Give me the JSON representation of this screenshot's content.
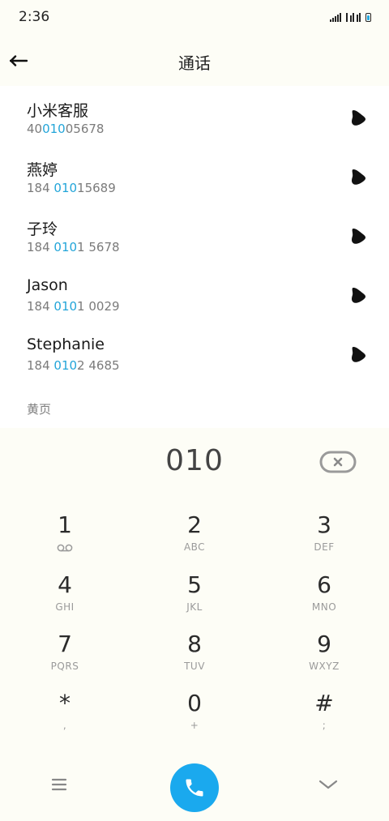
{
  "status_bar": {
    "time": "2:36"
  },
  "header": {
    "title": "通话"
  },
  "contacts": [
    {
      "name": "小米客服",
      "number_pre": "40",
      "number_match": "010",
      "number_post": "05678"
    },
    {
      "name": "燕婷",
      "number_pre": "184 ",
      "number_match": "010",
      "number_post": "15689"
    },
    {
      "name": "子玲",
      "number_pre": "184 ",
      "number_match": "010",
      "number_post": "1 5678"
    },
    {
      "name": "Jason",
      "number_pre": "184 ",
      "number_match": "010",
      "number_post": "1 0029"
    },
    {
      "name": "Stephanie",
      "number_pre": "184 ",
      "number_match": "010",
      "number_post": "2 4685"
    }
  ],
  "section_label": "黄页",
  "dialer": {
    "input": "010",
    "keys": [
      {
        "digit": "1",
        "letters": ""
      },
      {
        "digit": "2",
        "letters": "ABC"
      },
      {
        "digit": "3",
        "letters": "DEF"
      },
      {
        "digit": "4",
        "letters": "GHI"
      },
      {
        "digit": "5",
        "letters": "JKL"
      },
      {
        "digit": "6",
        "letters": "MNO"
      },
      {
        "digit": "7",
        "letters": "PQRS"
      },
      {
        "digit": "8",
        "letters": "TUV"
      },
      {
        "digit": "9",
        "letters": "WXYZ"
      },
      {
        "digit": "*",
        "letters": ","
      },
      {
        "digit": "0",
        "letters": "+"
      },
      {
        "digit": "#",
        "letters": ";"
      }
    ]
  },
  "icons": {
    "back": "arrow-left-icon",
    "call": "phone-icon",
    "delete": "backspace-icon",
    "voicemail": "voicemail-icon",
    "menu": "menu-icon",
    "collapse": "chevron-down-icon"
  },
  "colors": {
    "accent": "#1aa9ee",
    "highlight": "#23a5d9",
    "background": "#fdfdf6"
  }
}
